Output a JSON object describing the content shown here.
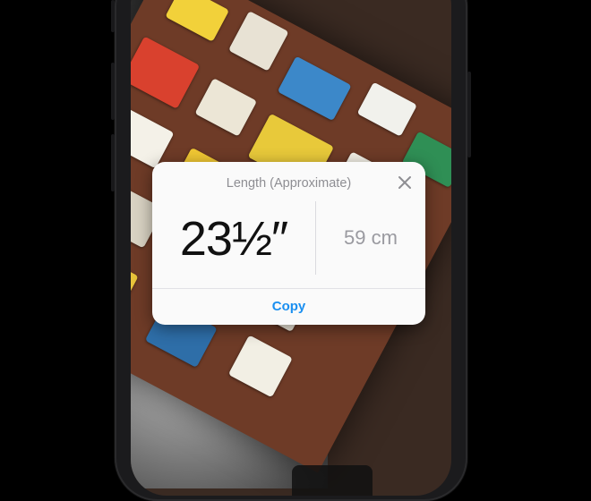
{
  "dialog": {
    "title": "Length (Approximate)",
    "primary_measurement": "23½″",
    "secondary_measurement": "59 cm",
    "copy_label": "Copy",
    "close_icon": "close-icon"
  },
  "colors": {
    "accent": "#1a8ff0",
    "card_background": "#fafafa",
    "muted_text": "#8e8e93"
  }
}
